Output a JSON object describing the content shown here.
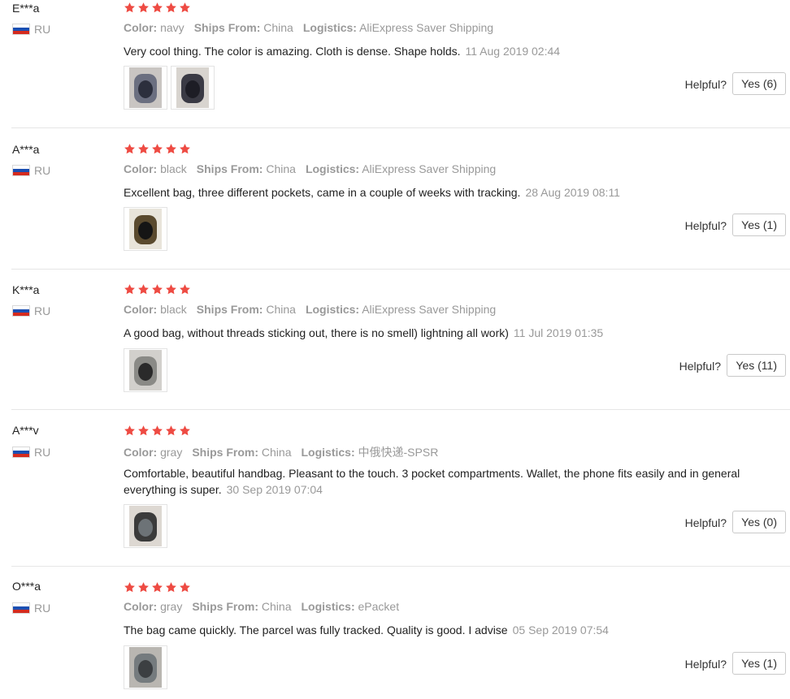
{
  "colors": {
    "star": "#ee4b43",
    "muted": "#999999",
    "flag_white": "#ffffff",
    "flag_blue": "#1b4fb2",
    "flag_red": "#d52b1e"
  },
  "labels": {
    "color_key": "Color:",
    "ships_key": "Ships From:",
    "logistics_key": "Logistics:",
    "helpful": "Helpful?"
  },
  "reviews": [
    {
      "user": "E***a",
      "country": "RU",
      "stars": 5,
      "color": "navy",
      "ships_from": "China",
      "logistics": "AliExpress Saver Shipping",
      "text": "Very cool thing. The color is amazing. Cloth is dense. Shape holds.",
      "date": "11 Aug 2019 02:44",
      "images": [
        "photo-thumbnail",
        "photo-thumbnail"
      ],
      "helpful_btn": "Yes (6)"
    },
    {
      "user": "A***a",
      "country": "RU",
      "stars": 5,
      "color": "black",
      "ships_from": "China",
      "logistics": "AliExpress Saver Shipping",
      "text": "Excellent bag, three different pockets, came in a couple of weeks with tracking.",
      "date": "28 Aug 2019 08:11",
      "images": [
        "photo-thumbnail"
      ],
      "helpful_btn": "Yes (1)"
    },
    {
      "user": "K***a",
      "country": "RU",
      "stars": 5,
      "color": "black",
      "ships_from": "China",
      "logistics": "AliExpress Saver Shipping",
      "text": "A good bag, without threads sticking out, there is no smell) lightning all work)",
      "date": "11 Jul 2019 01:35",
      "images": [
        "photo-thumbnail"
      ],
      "helpful_btn": "Yes (11)"
    },
    {
      "user": "A***v",
      "country": "RU",
      "stars": 5,
      "color": "gray",
      "ships_from": "China",
      "logistics": "中俄快递-SPSR",
      "text": "Comfortable, beautiful handbag. Pleasant to the touch. 3 pocket compartments. Wallet, the phone fits easily and in general everything is super.",
      "date": "30 Sep 2019 07:04",
      "images": [
        "photo-thumbnail"
      ],
      "helpful_btn": "Yes (0)"
    },
    {
      "user": "O***a",
      "country": "RU",
      "stars": 5,
      "color": "gray",
      "ships_from": "China",
      "logistics": "ePacket",
      "text": "The bag came quickly. The parcel was fully tracked. Quality is good. I advise",
      "date": "05 Sep 2019 07:54",
      "images": [
        "photo-thumbnail"
      ],
      "helpful_btn": "Yes (1)"
    }
  ]
}
